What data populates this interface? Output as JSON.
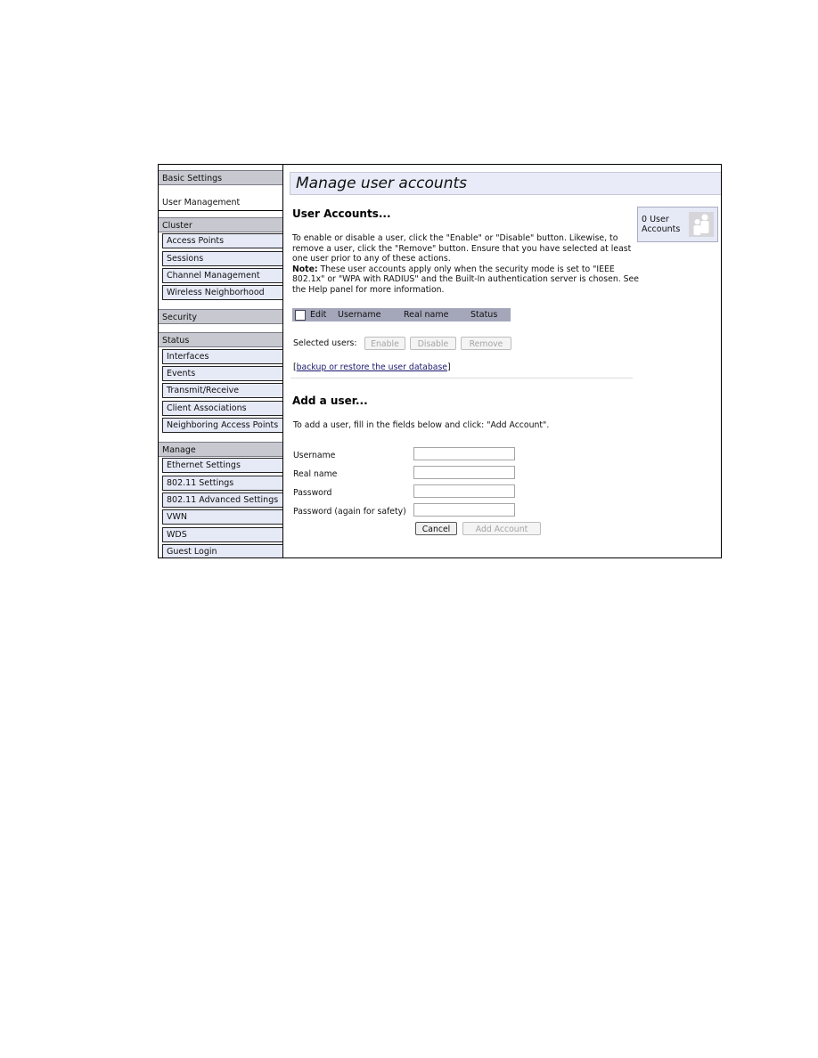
{
  "sidebar": {
    "basic_settings": "Basic Settings",
    "user_management": "User Management",
    "cluster": {
      "label": "Cluster",
      "items": [
        "Access Points",
        "Sessions",
        "Channel Management",
        "Wireless Neighborhood"
      ]
    },
    "security": "Security",
    "status": {
      "label": "Status",
      "items": [
        "Interfaces",
        "Events",
        "Transmit/Receive",
        "Client Associations",
        "Neighboring Access Points"
      ]
    },
    "manage": {
      "label": "Manage",
      "items": [
        "Ethernet Settings",
        "802.11 Settings",
        "802.11 Advanced Settings",
        "VWN",
        "WDS",
        "Guest Login"
      ]
    }
  },
  "main": {
    "page_title": "Manage user accounts",
    "user_accounts_heading": "User Accounts...",
    "instructions_1": "To enable or disable a user, click the \"Enable\" or \"Disable\" button. Likewise, to remove a user, click the \"Remove\" button. Ensure that you have selected at least one user prior to any of these actions.",
    "note_label": "Note:",
    "note_text": " These user accounts apply only when the security mode is set to \"IEEE 802.1x\" or \"WPA with RADIUS\" and the Built-In authentication server is chosen. See the Help panel for more information.",
    "badge": {
      "count": "0",
      "label_line1": "User",
      "label_line2": "Accounts",
      "icon": "users-icon"
    },
    "table": {
      "columns": [
        "Edit",
        "Username",
        "Real name",
        "Status"
      ],
      "rows": []
    },
    "selected_users_label": "Selected users:",
    "buttons": {
      "enable": "Enable",
      "disable": "Disable",
      "remove": "Remove"
    },
    "backup_link": {
      "prefix": "[",
      "text": "backup or restore the user database",
      "suffix": "]"
    },
    "add_user_heading": "Add a user...",
    "add_user_instructions": "To add a user, fill in the fields below and click: \"Add Account\".",
    "form": {
      "username_label": "Username",
      "username_value": "",
      "realname_label": "Real name",
      "realname_value": "",
      "password_label": "Password",
      "password_value": "",
      "password2_label": "Password (again for safety)",
      "password2_value": "",
      "cancel": "Cancel",
      "add_account": "Add Account"
    }
  }
}
